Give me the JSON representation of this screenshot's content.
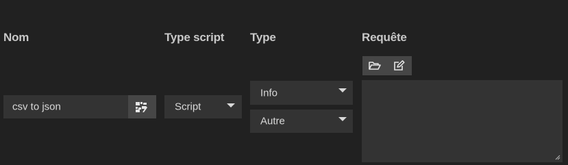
{
  "columns": {
    "name": "Nom",
    "script_type": "Type script",
    "type": "Type",
    "request": "Requête"
  },
  "name_field": {
    "value": "csv to json",
    "action_icon": "generate-icon"
  },
  "script_type_select": {
    "value": "Script"
  },
  "type_selects": [
    {
      "value": "Info"
    },
    {
      "value": "Autre"
    }
  ],
  "request": {
    "open_icon": "folder-open-icon",
    "edit_icon": "edit-icon",
    "value": ""
  }
}
